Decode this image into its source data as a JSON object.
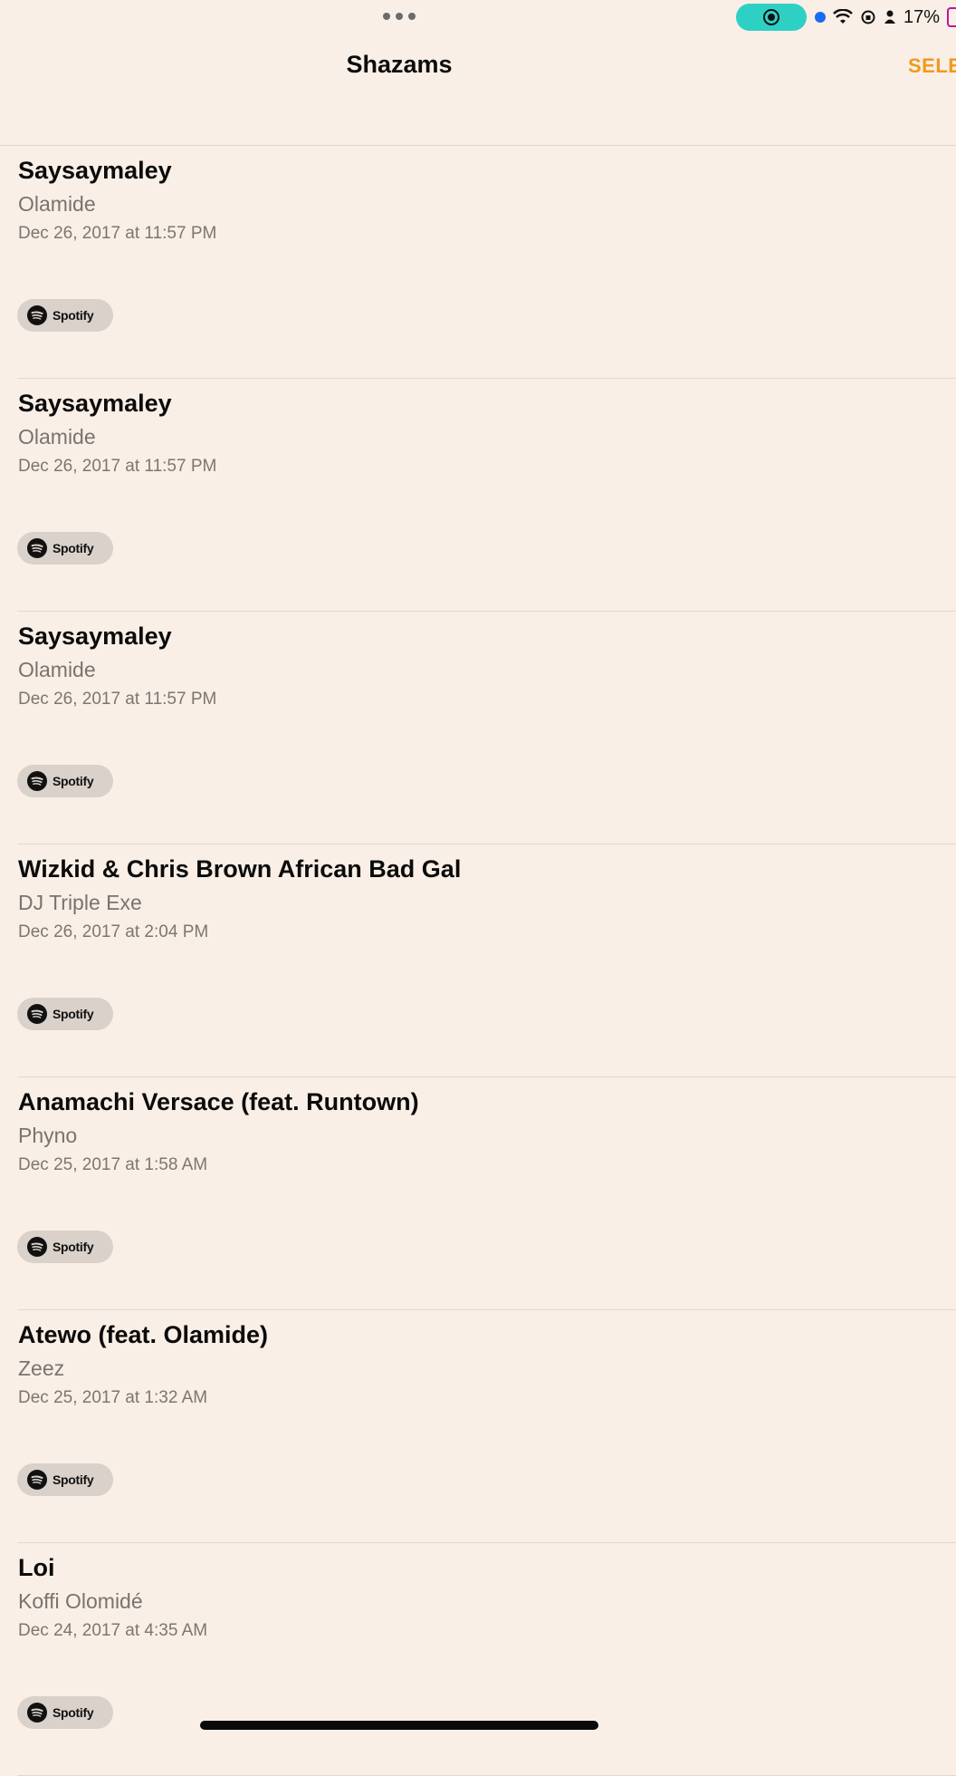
{
  "status_bar": {
    "battery_percent": "17%",
    "icons": [
      "more-dots-icon",
      "screen-record-icon",
      "location-dot-icon",
      "wifi-icon",
      "orientation-lock-icon",
      "person-icon",
      "battery-icon"
    ]
  },
  "nav": {
    "title": "Shazams",
    "select_label": "SELECT"
  },
  "items": [
    {
      "title": "Saysaymaley",
      "artist": "Olamide",
      "date": "Dec 26, 2017 at 11:57 PM",
      "service": "Spotify"
    },
    {
      "title": "Saysaymaley",
      "artist": "Olamide",
      "date": "Dec 26, 2017 at 11:57 PM",
      "service": "Spotify"
    },
    {
      "title": "Saysaymaley",
      "artist": "Olamide",
      "date": "Dec 26, 2017 at 11:57 PM",
      "service": "Spotify"
    },
    {
      "title": "Wizkid & Chris Brown African Bad Gal",
      "artist": "DJ Triple Exe",
      "date": "Dec 26, 2017 at 2:04 PM",
      "service": "Spotify"
    },
    {
      "title": "Anamachi Versace (feat. Runtown)",
      "artist": "Phyno",
      "date": "Dec 25, 2017 at 1:58 AM",
      "service": "Spotify"
    },
    {
      "title": "Atewo (feat. Olamide)",
      "artist": "Zeez",
      "date": "Dec 25, 2017 at 1:32 AM",
      "service": "Spotify"
    },
    {
      "title": "Loi",
      "artist": "Koffi Olomidé",
      "date": "Dec 24, 2017 at 4:35 AM",
      "service": "Spotify"
    }
  ],
  "colors": {
    "background": "#f9efe6",
    "accent": "#f09a1d",
    "record_pill": "#2fd0c4"
  }
}
